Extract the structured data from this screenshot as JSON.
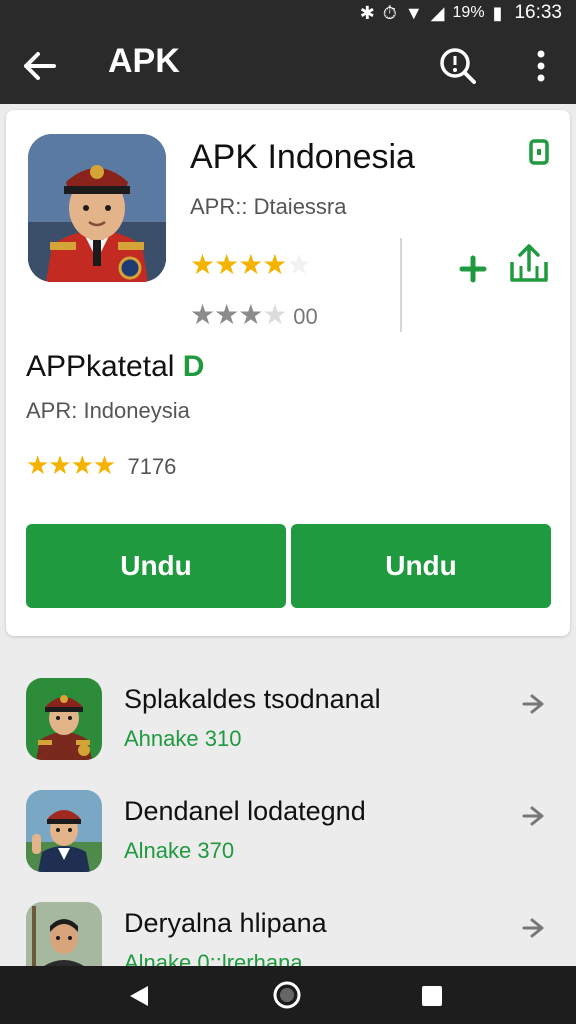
{
  "status_bar": {
    "battery_pct": "19%",
    "time": "16:33"
  },
  "app_bar": {
    "title": "APK"
  },
  "featured": {
    "name": "APK Indonesia",
    "subtitle": "APR:: Dtaiessra",
    "rating_primary": 4,
    "rating_secondary": 3,
    "rating_secondary_label": "00"
  },
  "section": {
    "title": "APPkatetal",
    "title_accent": "D",
    "subtitle": "APR: Indoneysia",
    "rating": 4,
    "rating_count": "7176"
  },
  "buttons": {
    "download_1": "Undu",
    "download_2": "Undu"
  },
  "list": [
    {
      "title": "Splakaldes tsodnanal",
      "subtitle": "Ahnake 310"
    },
    {
      "title": "Dendanel lodategnd",
      "subtitle": "Alnake 370"
    },
    {
      "title": "Deryalna hlipana",
      "subtitle": "Alnake 0::lrerhana"
    }
  ],
  "colors": {
    "accent": "#1f9a3e",
    "star": "#f5b301",
    "bar": "#2a2a2a"
  }
}
